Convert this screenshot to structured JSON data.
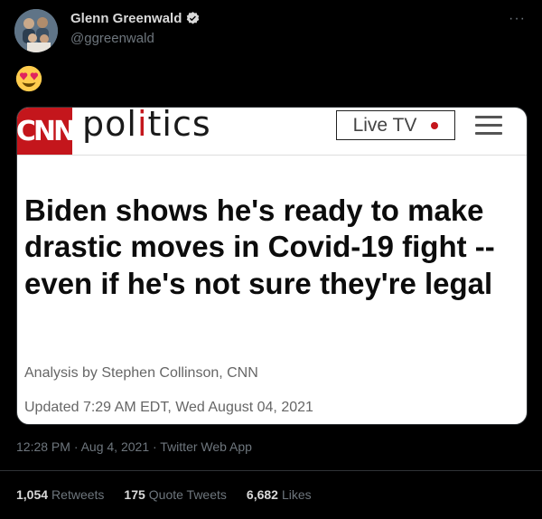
{
  "tweet": {
    "author_name": "Glenn Greenwald",
    "author_handle": "@ggreenwald",
    "more_label": "···",
    "emoji_name": "smiling-face-with-heart-eyes-icon",
    "timestamp": "12:28 PM · Aug 4, 2021 · Twitter Web App"
  },
  "card": {
    "logo_text": "CNN",
    "section_prefix": "pol",
    "section_highlight": "i",
    "section_suffix": "tics",
    "live_label": "Live TV",
    "headline": "Biden shows he's ready to make drastic moves in Covid-19 fight -- even if he's not sure they're legal",
    "byline": "Analysis by Stephen Collinson, CNN",
    "updated": "Updated 7:29 AM EDT, Wed August 04, 2021"
  },
  "stats": {
    "retweets_count": "1,054",
    "retweets_label": "Retweets",
    "quotes_count": "175",
    "quotes_label": "Quote Tweets",
    "likes_count": "6,682",
    "likes_label": "Likes"
  },
  "colors": {
    "background": "#000000",
    "cnn_red": "#c4161c",
    "verified_blue": "#d9d9d9"
  }
}
